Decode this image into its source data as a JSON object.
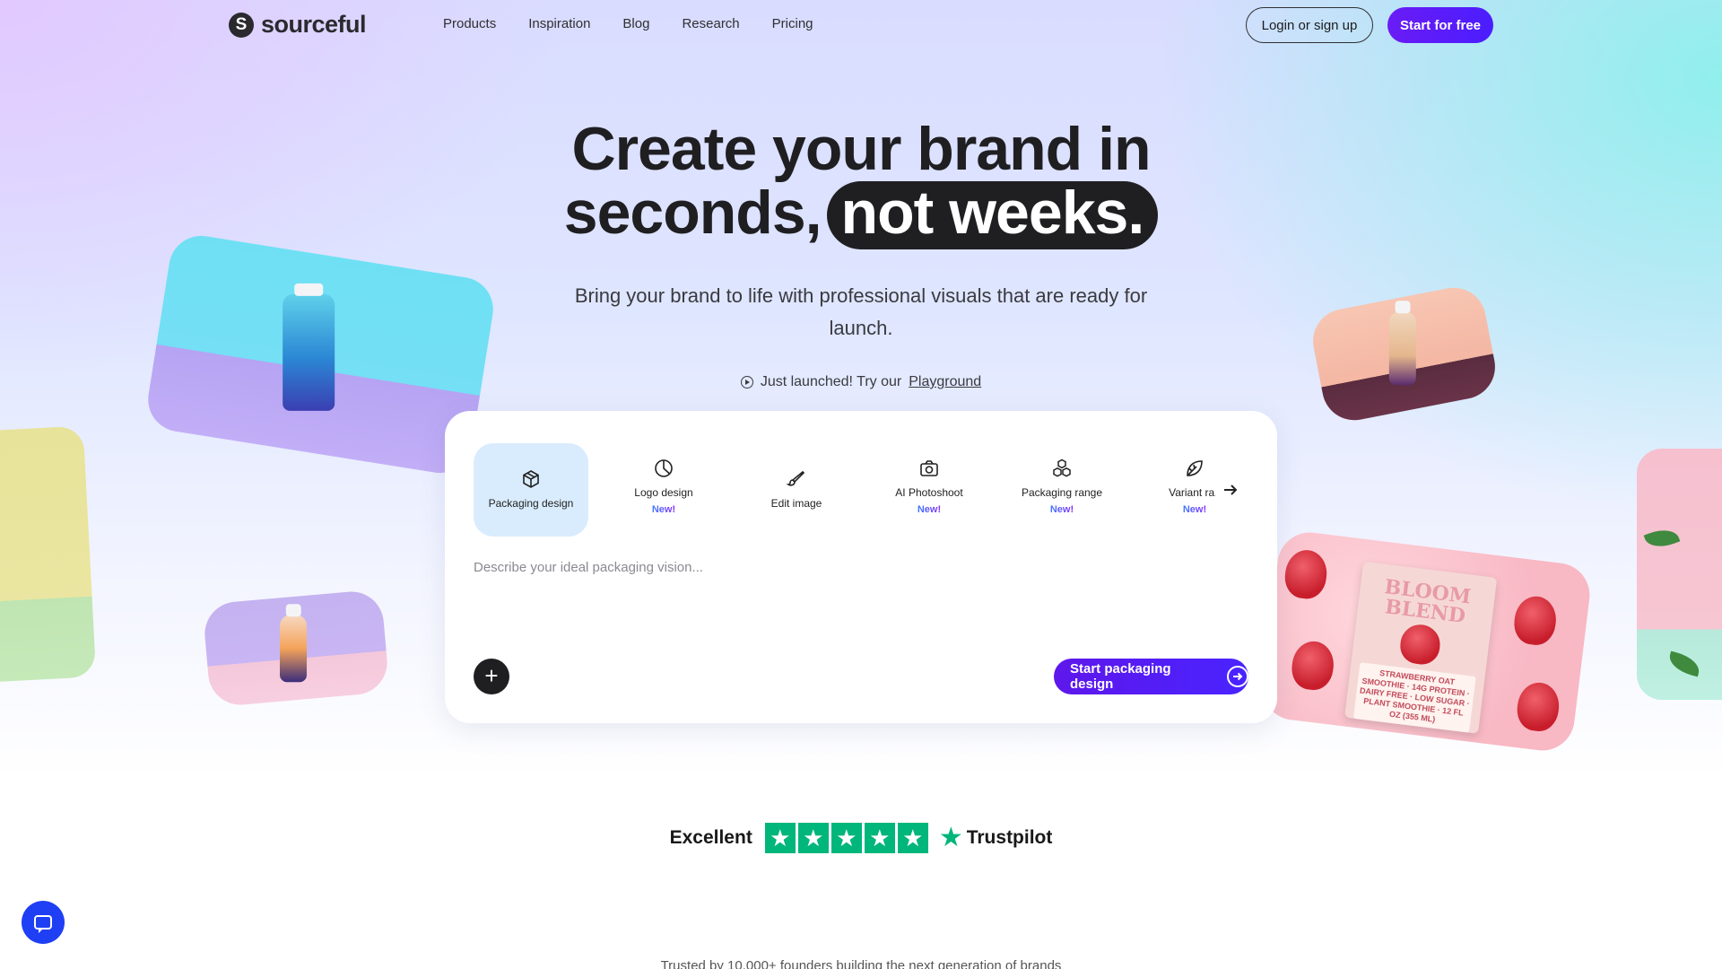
{
  "nav": {
    "logo_text": "sourceful",
    "logo_glyph": "S",
    "links": [
      "Products",
      "Inspiration",
      "Blog",
      "Research",
      "Pricing"
    ],
    "login_label": "Login or sign up",
    "start_label": "Start for free"
  },
  "hero": {
    "headline_line1": "Create your brand in",
    "headline_line2": "seconds,",
    "headline_highlight": "not weeks.",
    "subtitle": "Bring your brand to life with professional visuals that are ready for launch.",
    "launched_text": "Just launched! Try our",
    "launched_link": "Playground"
  },
  "panel": {
    "tabs": [
      {
        "label": "Packaging design",
        "icon": "box-icon",
        "badge": ""
      },
      {
        "label": "Logo design",
        "icon": "pie-icon",
        "badge": "New!"
      },
      {
        "label": "Edit image",
        "icon": "brush-icon",
        "badge": ""
      },
      {
        "label": "AI Photoshoot",
        "icon": "camera-icon",
        "badge": "New!"
      },
      {
        "label": "Packaging range",
        "icon": "boxes-icon",
        "badge": "New!"
      },
      {
        "label": "Variant ran",
        "icon": "leaf-icon",
        "badge": "New!"
      }
    ],
    "prompt_placeholder": "Describe your ideal packaging vision...",
    "submit_label": "Start packaging design"
  },
  "products": {
    "bloom_title": "BLOOM BLEND",
    "bloom_sub": "STRAWBERRY OAT SMOOTHIE · 14G PROTEIN · DAIRY FREE · LOW SUGAR · PLANT SMOOTHIE · 12 FL OZ (355 ML)"
  },
  "trust": {
    "rating_word": "Excellent",
    "brand": "Trustpilot",
    "stars": 5
  },
  "trusted_text": "Trusted by 10,000+ founders building the next generation of brands",
  "colors": {
    "accent": "#5e17eb",
    "trustpilot_green": "#00b67a",
    "tab_active": "#d9ecfd",
    "chat_button": "#1f3ff5"
  }
}
